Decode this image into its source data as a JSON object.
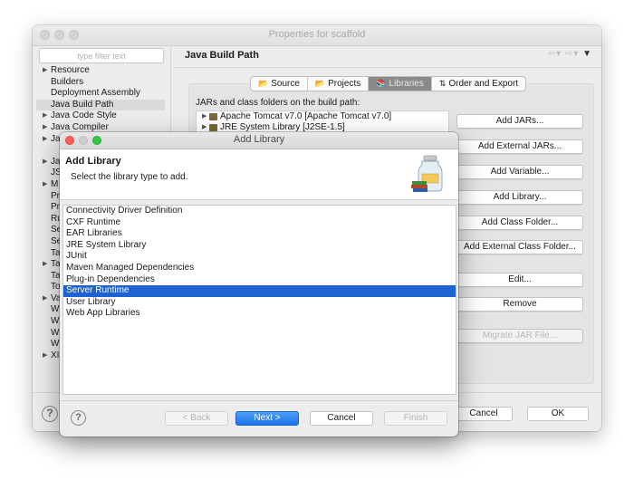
{
  "properties_window": {
    "title": "Properties for scaffold",
    "filter_placeholder": "type filter text",
    "tree": [
      {
        "label": "Resource",
        "arrow": "▶"
      },
      {
        "label": "Builders",
        "arrow": ""
      },
      {
        "label": "Deployment Assembly",
        "arrow": ""
      },
      {
        "label": "Java Build Path",
        "arrow": "",
        "selected": true
      },
      {
        "label": "Java Code Style",
        "arrow": "▶"
      },
      {
        "label": "Java Compiler",
        "arrow": "▶"
      },
      {
        "label": "Ja",
        "arrow": "▶"
      },
      {
        "label": "",
        "arrow": ""
      },
      {
        "label": "Ja",
        "arrow": "▶"
      },
      {
        "label": "JS",
        "arrow": ""
      },
      {
        "label": "M",
        "arrow": "▶"
      },
      {
        "label": "Pr",
        "arrow": ""
      },
      {
        "label": "Pr",
        "arrow": ""
      },
      {
        "label": "Ru",
        "arrow": ""
      },
      {
        "label": "Se",
        "arrow": ""
      },
      {
        "label": "Se",
        "arrow": ""
      },
      {
        "label": "Ta",
        "arrow": ""
      },
      {
        "label": "Ta",
        "arrow": "▶"
      },
      {
        "label": "Ta",
        "arrow": ""
      },
      {
        "label": "To",
        "arrow": ""
      },
      {
        "label": "Va",
        "arrow": "▶"
      },
      {
        "label": "W",
        "arrow": ""
      },
      {
        "label": "W",
        "arrow": ""
      },
      {
        "label": "W",
        "arrow": ""
      },
      {
        "label": "W",
        "arrow": ""
      },
      {
        "label": "XI",
        "arrow": "▶"
      }
    ],
    "page_title": "Java Build Path",
    "nav_back": "⇦",
    "nav_forward": "⇨",
    "nav_menu": "▼",
    "tabs": [
      {
        "label": "Source",
        "icon": "📂",
        "active": false
      },
      {
        "label": "Projects",
        "icon": "📂",
        "active": false
      },
      {
        "label": "Libraries",
        "icon": "📚",
        "active": true
      },
      {
        "label": "Order and Export",
        "icon": "⇅",
        "active": false
      }
    ],
    "libraries_label": "JARs and class folders on the build path:",
    "jars": [
      {
        "label": "Apache Tomcat v7.0 [Apache Tomcat v7.0]"
      },
      {
        "label": "JRE System Library [J2SE-1.5]"
      }
    ],
    "buttons": {
      "add_jars": "Add JARs...",
      "add_external_jars": "Add External JARs...",
      "add_variable": "Add Variable...",
      "add_library": "Add Library...",
      "add_class_folder": "Add Class Folder...",
      "add_external_class_folder": "Add External Class Folder...",
      "edit": "Edit...",
      "remove": "Remove",
      "migrate_jar": "Migrate JAR File..."
    },
    "footer": {
      "help": "?",
      "cancel": "Cancel",
      "ok": "OK"
    }
  },
  "add_library_dialog": {
    "title": "Add Library",
    "heading": "Add Library",
    "subtitle": "Select the library type to add.",
    "types": [
      {
        "label": "Connectivity Driver Definition"
      },
      {
        "label": "CXF Runtime"
      },
      {
        "label": "EAR Libraries"
      },
      {
        "label": "JRE System Library"
      },
      {
        "label": "JUnit"
      },
      {
        "label": "Maven Managed Dependencies"
      },
      {
        "label": "Plug-in Dependencies"
      },
      {
        "label": "Server Runtime",
        "selected": true
      },
      {
        "label": "User Library"
      },
      {
        "label": "Web App Libraries"
      }
    ],
    "footer": {
      "help": "?",
      "back": "< Back",
      "next": "Next >",
      "cancel": "Cancel",
      "finish": "Finish"
    }
  },
  "colors": {
    "selection": "#1f63d2",
    "primary_button": "#1a73e8",
    "close_button": "#fc605b",
    "zoom_button": "#34c84a"
  }
}
